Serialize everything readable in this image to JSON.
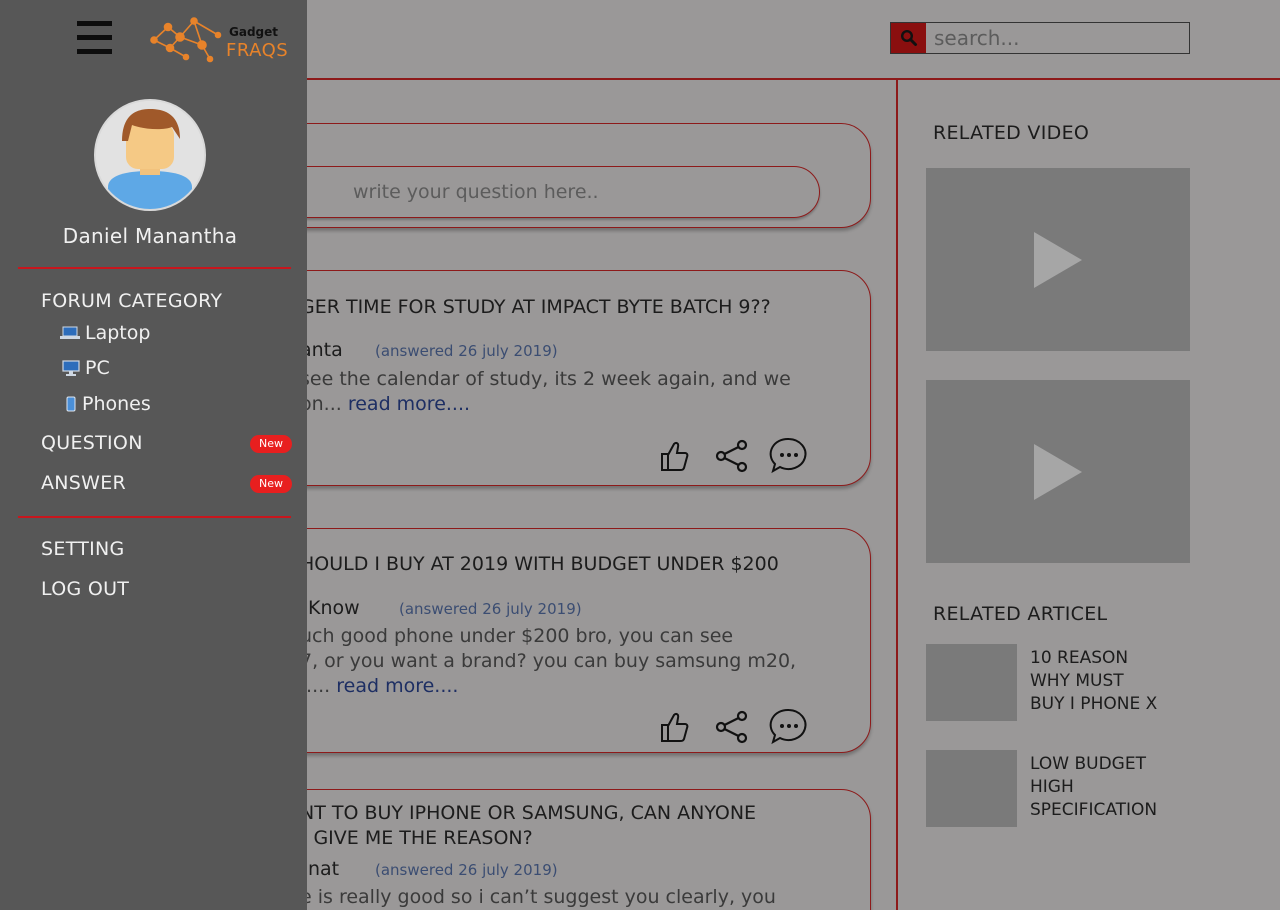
{
  "header": {
    "search_placeholder": "search..."
  },
  "ask": {
    "placeholder": "write your question here.."
  },
  "posts": [
    {
      "title": "GER TIME FOR STUDY  AT IMPACT BYTE BATCH 9??",
      "user": "anta",
      "date": "(answered 26 july 2019)",
      "excerpt_lines": [
        "see the calendar of study, its 2 week again, and we",
        "on..."
      ],
      "read_more": "read more...."
    },
    {
      "title": "HOULD I BUY AT 2019 WITH BUDGET UNDER $200",
      "user": "Know",
      "date": "(answered 26 july 2019)",
      "excerpt_lines": [
        "uch good phone under $200 bro, you can see",
        "7, or you want a brand? you can buy samsung m20,",
        "....."
      ],
      "read_more": "read more...."
    },
    {
      "title_lines": [
        "NT TO BUY IPHONE OR SAMSUNG, CAN ANYONE",
        ") GIVE ME THE REASON?"
      ],
      "user": "nat",
      "date": "(answered 26 july 2019)",
      "excerpt_lines": [
        "e is really good so i can’t suggest you clearly, you"
      ]
    }
  ],
  "sidebar_right": {
    "video_title": "RELATED VIDEO",
    "article_title": "RELATED ARTICEL",
    "articles": [
      {
        "lines": [
          "10 REASON",
          "WHY MUST",
          "BUY I PHONE X"
        ]
      },
      {
        "lines": [
          "LOW BUDGET",
          "HIGH",
          "SPECIFICATION"
        ]
      }
    ]
  },
  "drawer": {
    "logo_top": "Gadget",
    "logo_bottom": "FRAQS",
    "user_name": "Daniel Manantha",
    "forum_category": "FORUM CATEGORY",
    "categories": [
      {
        "label": "Laptop",
        "icon": "laptop-icon"
      },
      {
        "label": "PC",
        "icon": "monitor-icon"
      },
      {
        "label": "Phones",
        "icon": "phone-icon"
      }
    ],
    "question": "QUESTION",
    "answer": "ANSWER",
    "badge": "New",
    "setting": "SETTING",
    "logout": "LOG OUT"
  },
  "colors": {
    "accent_red": "#c8161d",
    "card_border": "#8d1a1a",
    "drawer_bg": "#575757",
    "logo_orange": "#e8832a",
    "badge_red": "#e81f1f"
  }
}
